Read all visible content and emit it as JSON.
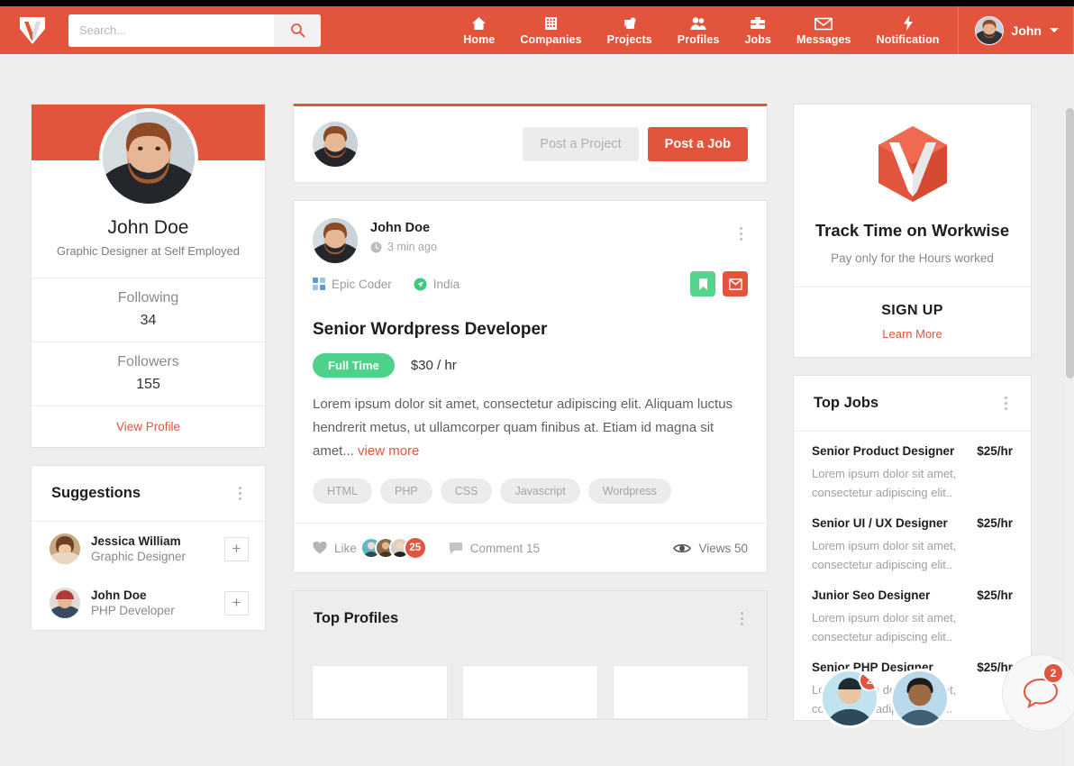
{
  "brand": {
    "name": "Workwise",
    "accent": "#e2543c",
    "green": "#4ed18a",
    "logo_icon": "workwise-w-logo"
  },
  "header": {
    "search": {
      "value": "",
      "placeholder": "Search...",
      "icon": "search-icon"
    },
    "nav": [
      {
        "label": "Home",
        "icon": "home-icon"
      },
      {
        "label": "Companies",
        "icon": "building-icon"
      },
      {
        "label": "Projects",
        "icon": "puzzle-icon"
      },
      {
        "label": "Profiles",
        "icon": "people-icon"
      },
      {
        "label": "Jobs",
        "icon": "briefcase-icon"
      },
      {
        "label": "Messages",
        "icon": "envelope-icon"
      },
      {
        "label": "Notification",
        "icon": "bolt-icon"
      }
    ],
    "user": {
      "name": "John",
      "avatar": "john-doe-avatar",
      "caret": "chevron-down-icon"
    }
  },
  "left": {
    "profile": {
      "name": "John Doe",
      "role": "Graphic Designer at Self Employed",
      "stats": [
        {
          "label": "Following",
          "value": "34"
        },
        {
          "label": "Followers",
          "value": "155"
        }
      ],
      "view_profile": "View Profile"
    },
    "suggestions": {
      "title": "Suggestions",
      "menu_icon": "kebab-menu-icon",
      "items": [
        {
          "name": "Jessica William",
          "role": "Graphic Designer",
          "add": "+"
        },
        {
          "name": "John Doe",
          "role": "PHP Developer",
          "add": "+"
        }
      ]
    }
  },
  "main": {
    "composer": {
      "avatar": "john-doe-avatar",
      "post_project_label": "Post a Project",
      "post_job_label": "Post a Job"
    },
    "post": {
      "author": "John Doe",
      "time": "3 min ago",
      "time_icon": "clock-icon",
      "menu_icon": "kebab-menu-icon",
      "company": "Epic Coder",
      "company_icon": "company-grid-icon",
      "location": "India",
      "location_icon": "location-send-icon",
      "bookmark_icon": "bookmark-icon",
      "mail_icon": "envelope-icon",
      "title": "Senior Wordpress Developer",
      "job_type": "Full Time",
      "rate": "$30 / hr",
      "body": "Lorem ipsum dolor sit amet, consectetur adipiscing elit. Aliquam luctus hendrerit metus, ut ullamcorper quam finibus at. Etiam id magna sit amet...",
      "view_more": "view more",
      "tags": [
        "HTML",
        "PHP",
        "CSS",
        "Javascript",
        "Wordpress"
      ],
      "like_label": "Like",
      "like_icon": "heart-icon",
      "like_count": "25",
      "comment_label": "Comment 15",
      "comment_icon": "comment-icon",
      "views_label": "Views 50",
      "views_icon": "eye-icon"
    },
    "top_profiles": {
      "title": "Top Profiles",
      "menu_icon": "kebab-menu-icon"
    }
  },
  "right": {
    "promo": {
      "logo_icon": "workwise-hex-logo",
      "title": "Track Time on Workwise",
      "subtitle": "Pay only for the Hours worked",
      "signup": "SIGN UP",
      "learn_more": "Learn More"
    },
    "top_jobs": {
      "title": "Top Jobs",
      "menu_icon": "kebab-menu-icon",
      "items": [
        {
          "name": "Senior Product Designer",
          "rate": "$25/hr",
          "desc": "Lorem ipsum dolor sit amet, consectetur adipiscing elit.."
        },
        {
          "name": "Senior UI / UX Designer",
          "rate": "$25/hr",
          "desc": "Lorem ipsum dolor sit amet, consectetur adipiscing elit.."
        },
        {
          "name": "Junior Seo Designer",
          "rate": "$25/hr",
          "desc": "Lorem ipsum dolor sit amet, consectetur adipiscing elit.."
        },
        {
          "name": "Senior PHP Designer",
          "rate": "$25/hr",
          "desc": "Lorem ipsum dolor sit amet, consectetur adipiscing elit.."
        }
      ]
    }
  },
  "chat": {
    "bubbles": [
      {
        "avatar": "chat-contact-avatar-1",
        "badge": "2"
      },
      {
        "avatar": "chat-contact-avatar-2",
        "badge": ""
      }
    ],
    "toggle": {
      "icon": "chat-toggle-icon",
      "badge": "2"
    }
  }
}
